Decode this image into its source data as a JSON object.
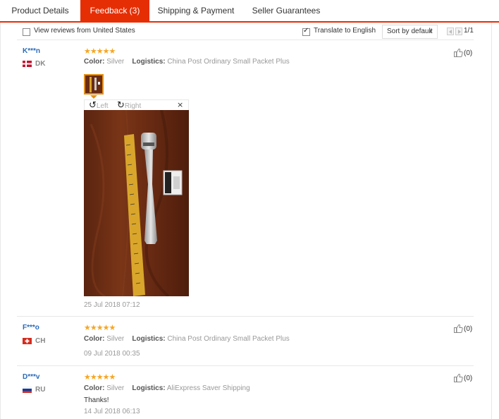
{
  "tabs": [
    {
      "label": "Product Details",
      "active": false
    },
    {
      "label": "Feedback (3)",
      "active": true
    },
    {
      "label": "Shipping & Payment",
      "active": false
    },
    {
      "label": "Seller Guarantees",
      "active": false
    }
  ],
  "filters": {
    "us_label": "View reviews from United States",
    "us_checked": false,
    "translate_label": "Translate to English",
    "translate_checked": true,
    "sort_value": "Sort by default",
    "page": "1/1"
  },
  "colors": {
    "accent": "#e62e04",
    "star": "#f5a623",
    "user_link": "#2a6ab8"
  },
  "reviews": [
    {
      "user": "K***n",
      "country": "DK",
      "flag": "flag-denmark",
      "stars": "★★★★★",
      "rating": 5,
      "color_label": "Color:",
      "color_value": "Silver",
      "logistics_label": "Logistics:",
      "logistics_value": "China Post Ordinary Small Packet Plus",
      "date": "25 Jul 2018 07:12",
      "likes": "(0)",
      "viewer": {
        "left": "Left",
        "right": "Right",
        "close": "×"
      }
    },
    {
      "user": "F***o",
      "country": "CH",
      "flag": "flag-switzerland",
      "stars": "★★★★★",
      "rating": 5,
      "color_label": "Color:",
      "color_value": "Silver",
      "logistics_label": "Logistics:",
      "logistics_value": "China Post Ordinary Small Packet Plus",
      "date": "09 Jul 2018 00:35",
      "likes": "(0)"
    },
    {
      "user": "D***v",
      "country": "RU",
      "flag": "flag-russia",
      "stars": "★★★★★",
      "rating": 5,
      "color_label": "Color:",
      "color_value": "Silver",
      "logistics_label": "Logistics:",
      "logistics_value": "AliExpress Saver Shipping",
      "text": "Thanks!",
      "date": "14 Jul 2018 06:13",
      "likes": "(0)"
    }
  ]
}
